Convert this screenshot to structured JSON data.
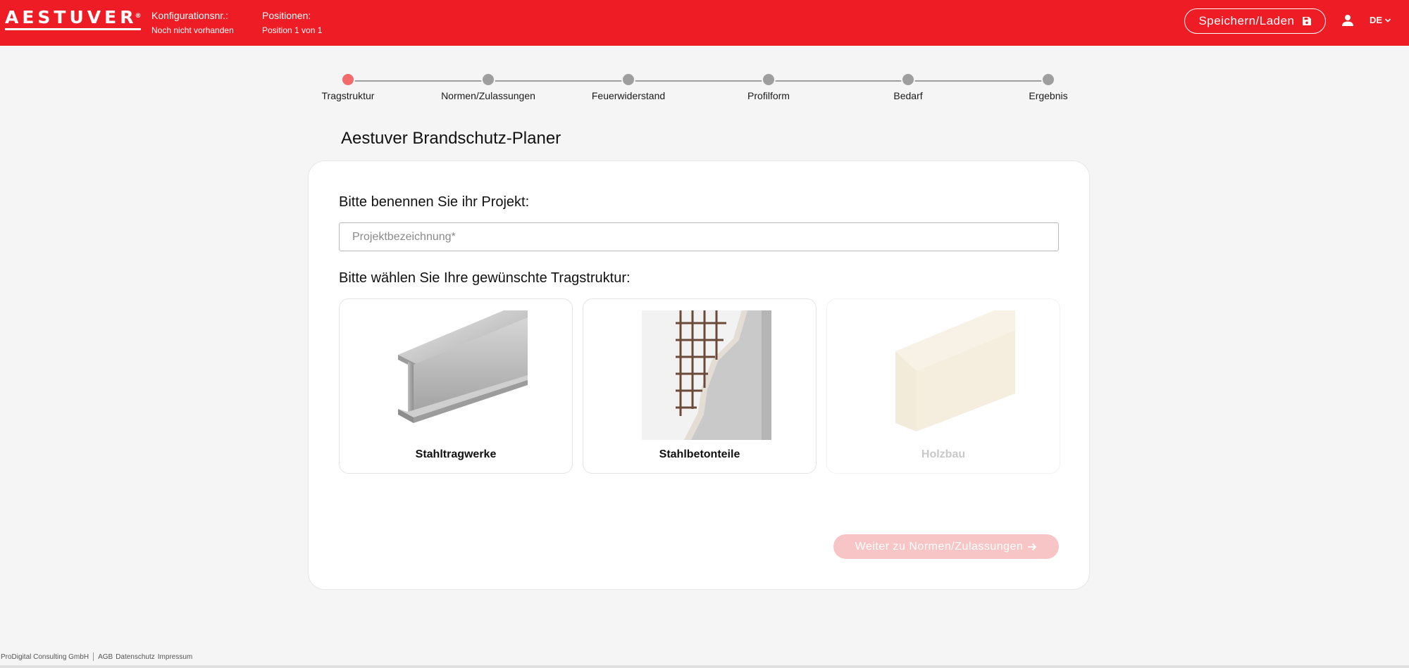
{
  "header": {
    "logo": "AESTUVER",
    "logo_mark": "®",
    "config_label": "Konfigurationsnr.:",
    "config_value": "Noch nicht vorhanden",
    "positions_label": "Positionen:",
    "positions_value": "Position 1 von 1",
    "save_load_label": "Speichern/Laden",
    "language": "DE",
    "background_color": "#ee1c25"
  },
  "stepper": {
    "active_index": 0,
    "steps": [
      {
        "label": "Tragstruktur"
      },
      {
        "label": "Normen/Zulassungen"
      },
      {
        "label": "Feuerwiderstand"
      },
      {
        "label": "Profilform"
      },
      {
        "label": "Bedarf"
      },
      {
        "label": "Ergebnis"
      }
    ]
  },
  "main": {
    "title": "Aestuver Brandschutz-Planer",
    "project_question": "Bitte benennen Sie ihr Projekt:",
    "project_placeholder": "Projektbezeichnung*",
    "project_value": "",
    "structure_question": "Bitte wählen Sie Ihre gewünschte Tragstruktur:",
    "structures": [
      {
        "label": "Stahltragwerke",
        "icon": "steel-beam-image",
        "enabled": true
      },
      {
        "label": "Stahlbetonteile",
        "icon": "reinforced-concrete-image",
        "enabled": true
      },
      {
        "label": "Holzbau",
        "icon": "timber-beam-image",
        "enabled": false
      }
    ],
    "next_label": "Weiter zu Normen/Zulassungen",
    "next_enabled": false
  },
  "footer": {
    "company": "ProDigital Consulting GmbH",
    "links": [
      "AGB",
      "Datenschutz",
      "Impressum"
    ]
  }
}
